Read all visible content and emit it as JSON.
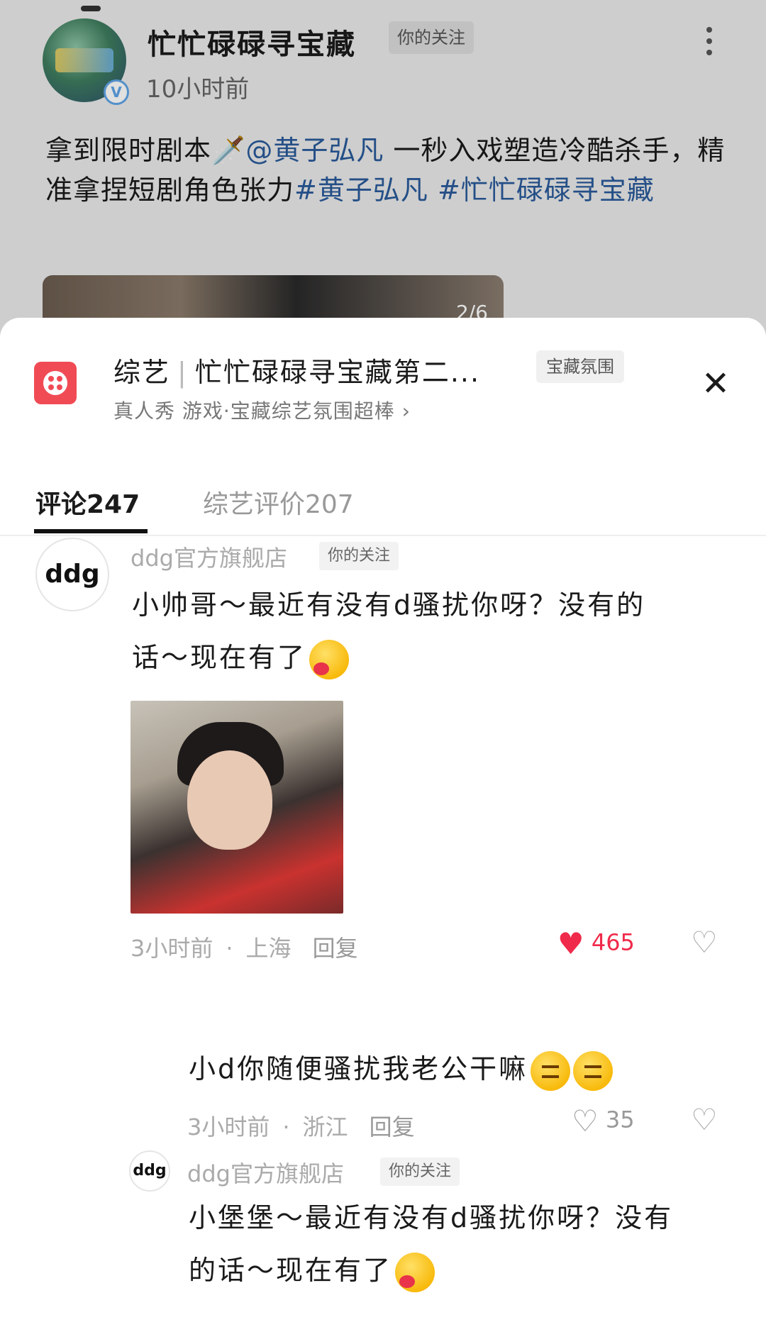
{
  "post": {
    "title": "忙忙碌碌寻宝藏",
    "follow_tag": "你的关注",
    "time": "10小时前",
    "text_prefix": "拿到限时剧本🗡️",
    "mention": "@黄子弘凡",
    "text_mid": " 一秒入戏塑造冷酷杀手，精准拿捏短剧角色张力",
    "hashtag1": "#黄子弘凡",
    "hashtag2": " #忙忙碌碌寻宝藏",
    "image_counter": "2/6",
    "verified_mark": "V"
  },
  "sheet": {
    "category": "综艺",
    "show_title": "忙忙碌碌寻宝藏第二...",
    "badge": "宝藏氛围",
    "subtitle": "真人秀 游戏·宝藏综艺氛围超棒",
    "subtitle_arrow": "›",
    "close": "✕",
    "tabs": [
      {
        "label": "评论247"
      },
      {
        "label": "综艺评价207"
      }
    ]
  },
  "comments": [
    {
      "avatar_text": "ddg",
      "user": "ddg官方旗舰店",
      "tag": "你的关注",
      "text_line1": "小帅哥～最近有没有d骚扰你呀？没有的",
      "text_line2": "话～现在有了",
      "time": "3小时前",
      "location": "上海",
      "reply": "回复",
      "likes": "465",
      "liked": true
    },
    {
      "text": "小d你随便骚扰我老公干嘛",
      "time": "3小时前",
      "location": "浙江",
      "reply": "回复",
      "likes": "35",
      "liked": false
    },
    {
      "avatar_text": "ddg",
      "user": "ddg官方旗舰店",
      "tag": "你的关注",
      "text_line1": "小堡堡～最近有没有d骚扰你呀？没有",
      "text_line2": "的话～现在有了"
    }
  ],
  "colors": {
    "accent_red": "#f02a4a",
    "hashtag_blue": "#2a5a9a",
    "show_icon_red": "#f04b55"
  },
  "icons": {
    "heart_filled": "♥",
    "heart_outline": "♡",
    "dislike": "♡"
  },
  "separator_dot": "·"
}
